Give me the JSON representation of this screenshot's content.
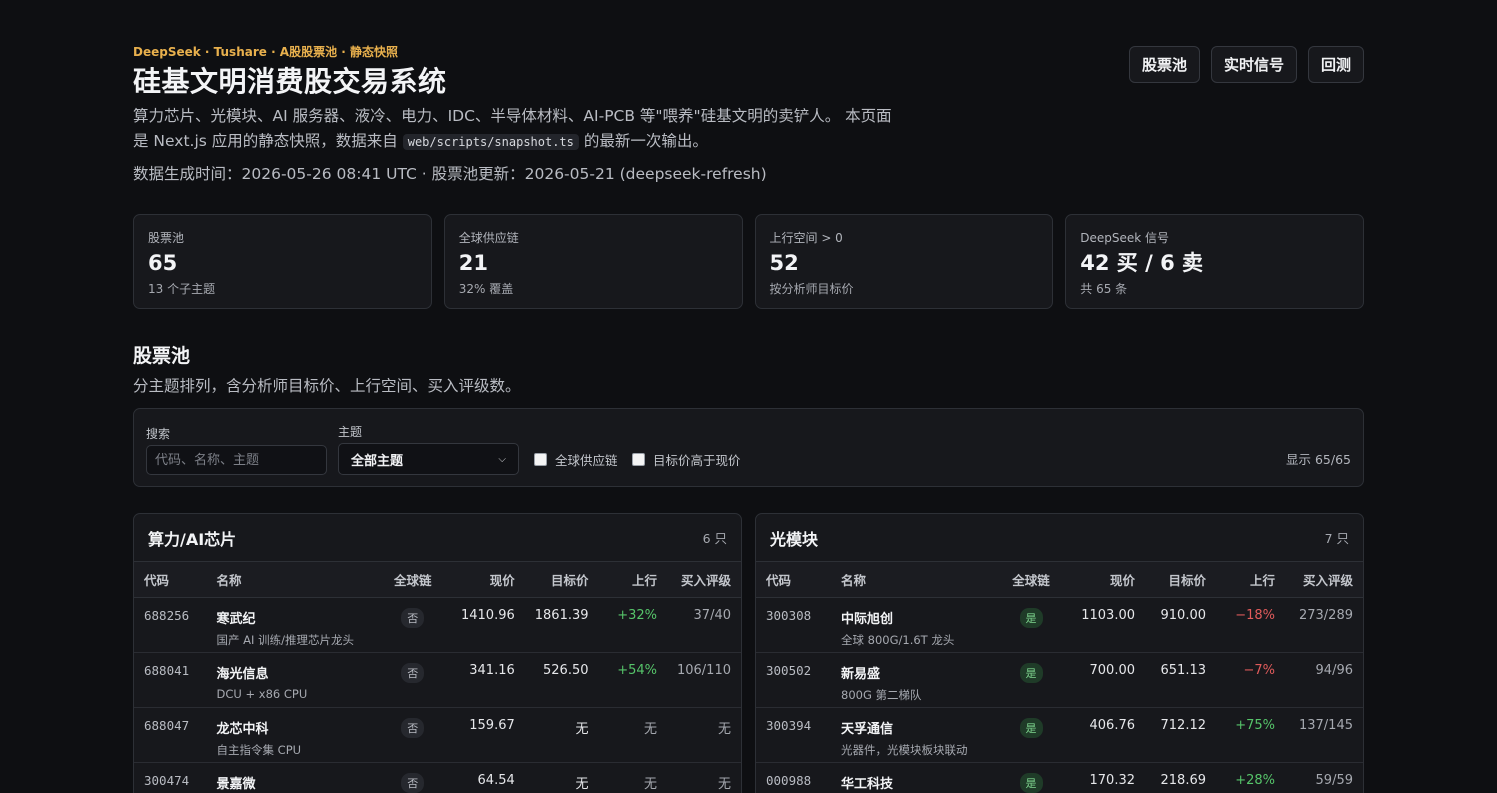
{
  "header": {
    "eyebrow": "DeepSeek · Tushare · A股股票池 · 静态快照",
    "title": "硅基文明消费股交易系统",
    "desc_pre": "算力芯片、光模块、AI 服务器、液冷、电力、IDC、半导体材料、AI-PCB 等\"喂养\"硅基文明的卖铲人。 本页面是 Next.js 应用的静态快照，数据来自",
    "desc_code": "web/scripts/snapshot.ts",
    "desc_post": "的最新一次输出。",
    "gentime": "数据生成时间：2026-05-26 08:41 UTC · 股票池更新：2026-05-21 (deepseek-refresh)"
  },
  "nav": {
    "pool": "股票池",
    "signals": "实时信号",
    "backtest": "回测"
  },
  "stats": [
    {
      "label": "股票池",
      "value": "65",
      "sub": "13 个子主题"
    },
    {
      "label": "全球供应链",
      "value": "21",
      "sub": "32% 覆盖"
    },
    {
      "label": "上行空间 > 0",
      "value": "52",
      "sub": "按分析师目标价"
    },
    {
      "label": "DeepSeek 信号",
      "value": "42 买 / 6 卖",
      "sub": "共 65 条"
    }
  ],
  "section": {
    "title": "股票池",
    "subtitle": "分主题排列，含分析师目标价、上行空间、买入评级数。"
  },
  "filters": {
    "search_label": "搜索",
    "search_placeholder": "代码、名称、主题",
    "theme_label": "主题",
    "theme_value": "全部主题",
    "chk_global": "全球供应链",
    "chk_target": "目标价高于现价",
    "count": "显示 65/65"
  },
  "columns": [
    "代码",
    "名称",
    "全球链",
    "现价",
    "目标价",
    "上行",
    "买入评级"
  ],
  "panels": [
    {
      "title": "算力/AI芯片",
      "count": "6 只",
      "rows": [
        {
          "code": "688256",
          "name": "寒武纪",
          "desc": "国产 AI 训练/推理芯片龙头",
          "global": "否",
          "price": "1410.96",
          "target": "1861.39",
          "upside": "+32%",
          "rating": "37/40"
        },
        {
          "code": "688041",
          "name": "海光信息",
          "desc": "DCU + x86 CPU",
          "global": "否",
          "price": "341.16",
          "target": "526.50",
          "upside": "+54%",
          "rating": "106/110"
        },
        {
          "code": "688047",
          "name": "龙芯中科",
          "desc": "自主指令集 CPU",
          "global": "否",
          "price": "159.67",
          "target": "无",
          "upside": "无",
          "rating": "无"
        },
        {
          "code": "300474",
          "name": "景嘉微",
          "desc": "",
          "global": "否",
          "price": "64.54",
          "target": "无",
          "upside": "无",
          "rating": "无"
        }
      ]
    },
    {
      "title": "光模块",
      "count": "7 只",
      "rows": [
        {
          "code": "300308",
          "name": "中际旭创",
          "desc": "全球 800G/1.6T 龙头",
          "global": "是",
          "price": "1103.00",
          "target": "910.00",
          "upside": "−18%",
          "rating": "273/289"
        },
        {
          "code": "300502",
          "name": "新易盛",
          "desc": "800G 第二梯队",
          "global": "是",
          "price": "700.00",
          "target": "651.13",
          "upside": "−7%",
          "rating": "94/96"
        },
        {
          "code": "300394",
          "name": "天孚通信",
          "desc": "光器件，光模块板块联动",
          "global": "是",
          "price": "406.76",
          "target": "712.12",
          "upside": "+75%",
          "rating": "137/145"
        },
        {
          "code": "000988",
          "name": "华工科技",
          "desc": "",
          "global": "是",
          "price": "170.32",
          "target": "218.69",
          "upside": "+28%",
          "rating": "59/59"
        }
      ]
    }
  ]
}
